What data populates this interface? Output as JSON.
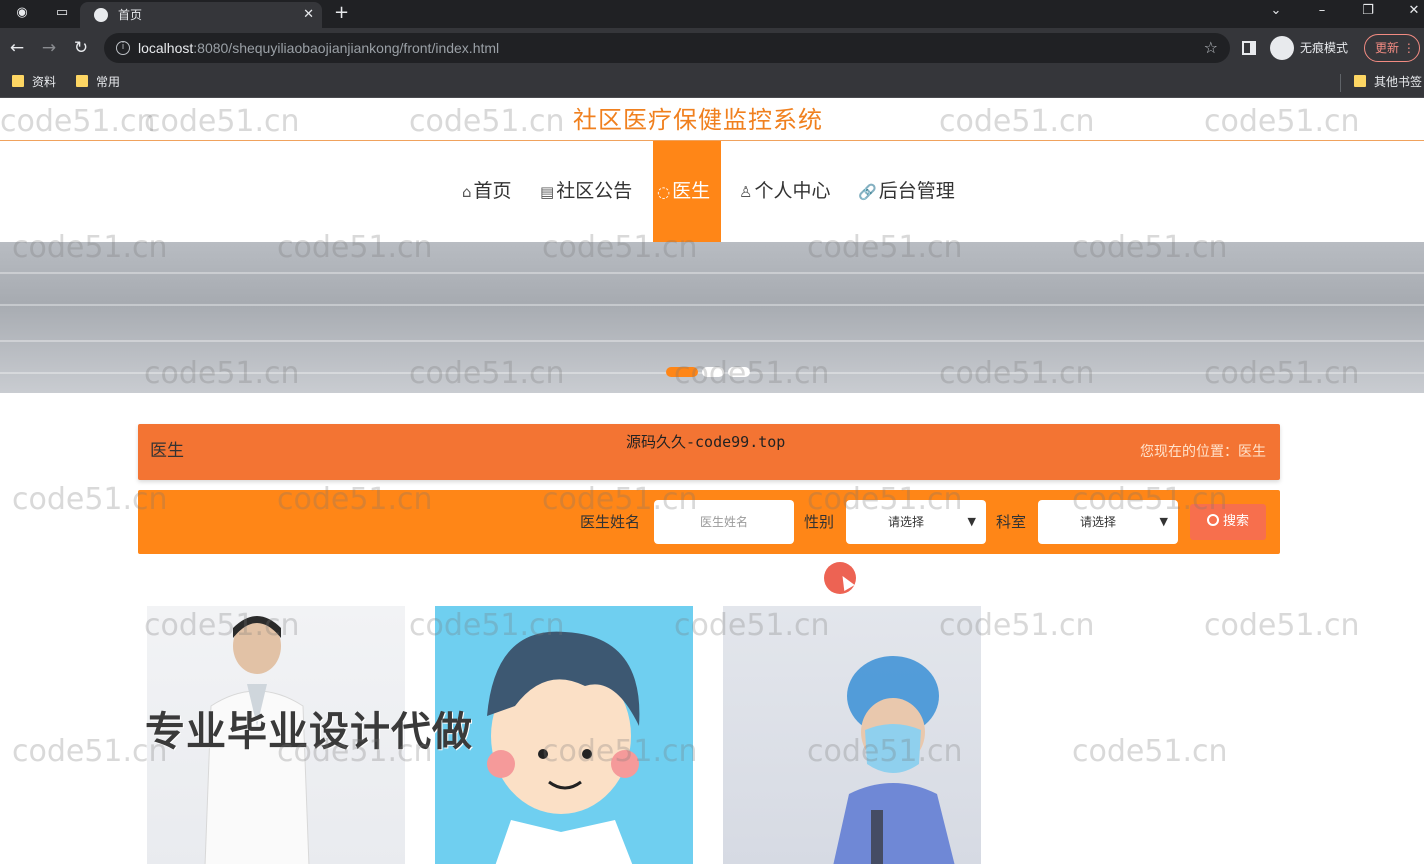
{
  "browser": {
    "tab_title": "首页",
    "url_host": "localhost",
    "url_rest": ":8080/shequyiliaobaojianjiankong/front/index.html",
    "incognito_label": "无痕模式",
    "update_label": "更新",
    "bookmarks": [
      "资料",
      "常用"
    ],
    "other_bookmarks": "其他书签"
  },
  "site": {
    "title": "社区医疗保健监控系统",
    "nav": [
      {
        "icon": "⌂",
        "label": "首页"
      },
      {
        "icon": "▤",
        "label": "社区公告"
      },
      {
        "icon": "◌",
        "label": "医生"
      },
      {
        "icon": "♙",
        "label": "个人中心"
      },
      {
        "icon": "🔗",
        "label": "后台管理"
      }
    ]
  },
  "panel": {
    "title": "医生",
    "center_text": "源码久久-code99.top",
    "crumb_prefix": "您现在的位置：",
    "crumb_current": "医生"
  },
  "search": {
    "name_label": "医生姓名",
    "name_placeholder": "医生姓名",
    "gender_label": "性别",
    "gender_value": "请选择",
    "dept_label": "科室",
    "dept_value": "请选择",
    "button_label": "搜索"
  },
  "overlay": {
    "promo_text": "专业毕业设计代做",
    "watermark": "code51.cn"
  },
  "colors": {
    "accent": "#ff8617",
    "panel": "#f37433",
    "title": "#f0801f"
  }
}
